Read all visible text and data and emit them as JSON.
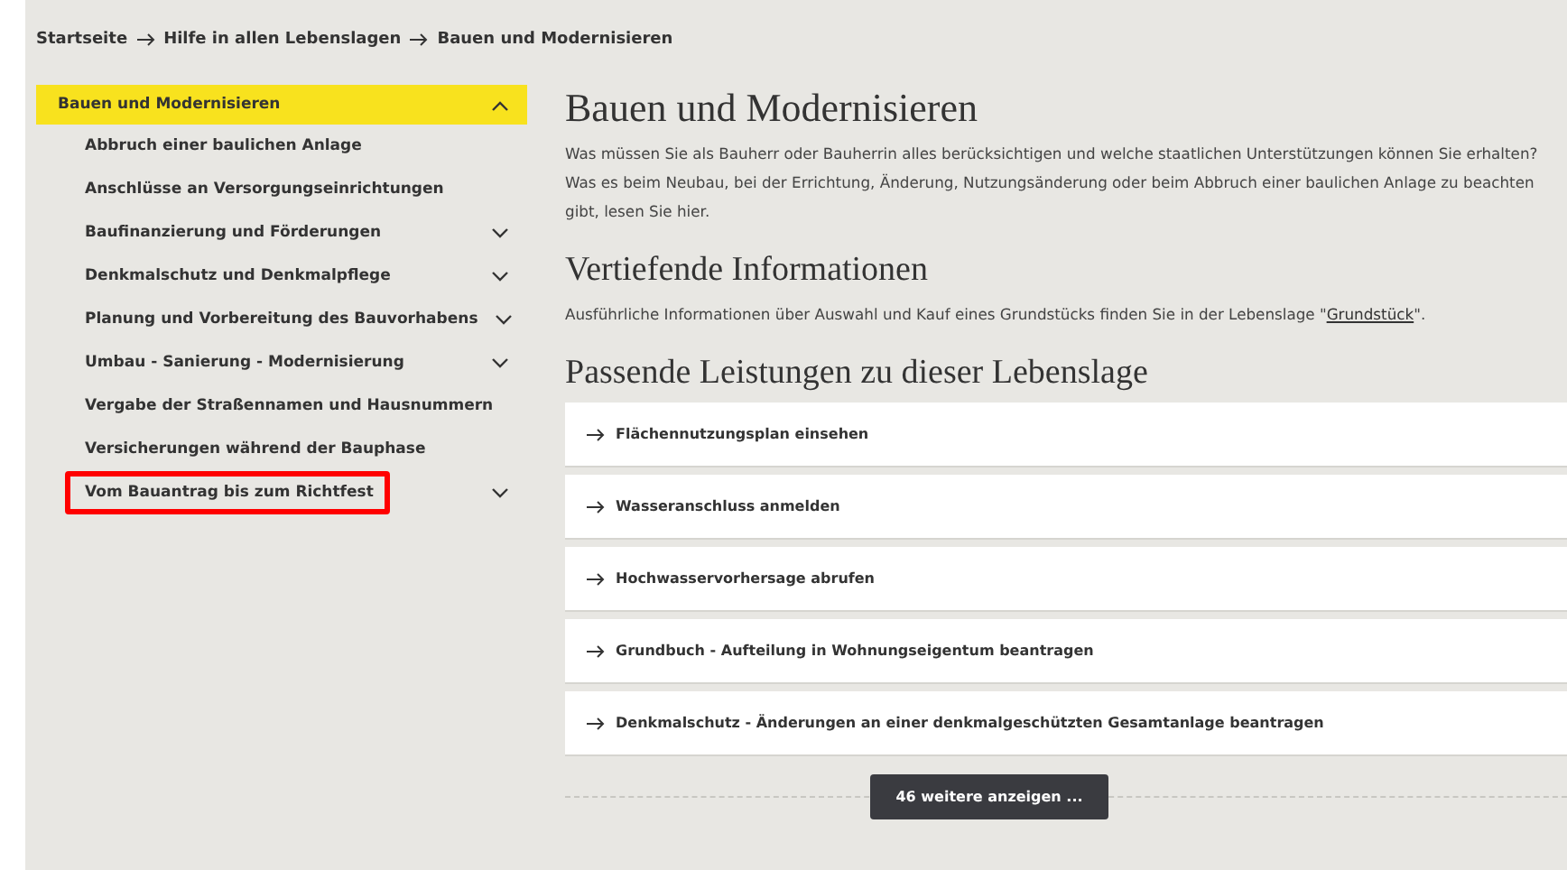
{
  "breadcrumb": [
    "Startseite",
    "Hilfe in allen Lebenslagen",
    "Bauen und Modernisieren"
  ],
  "sidebar": {
    "header": {
      "label": "Bauen und Modernisieren",
      "expanded": true
    },
    "items": [
      {
        "label": "Abbruch einer baulichen Anlage",
        "kind": "link",
        "highlighted": false
      },
      {
        "label": "Anschlüsse an Versorgungseinrichtungen",
        "kind": "link",
        "highlighted": false
      },
      {
        "label": "Baufinanzierung und Förderungen",
        "kind": "expandable",
        "highlighted": false
      },
      {
        "label": "Denkmalschutz und Denkmalpflege",
        "kind": "expandable",
        "highlighted": false
      },
      {
        "label": "Planung und Vorbereitung des Bauvorhabens",
        "kind": "expandable",
        "highlighted": false
      },
      {
        "label": "Umbau - Sanierung - Modernisierung",
        "kind": "expandable",
        "highlighted": false
      },
      {
        "label": "Vergabe der Straßennamen und Hausnummern",
        "kind": "link",
        "highlighted": false
      },
      {
        "label": "Versicherungen während der Bauphase",
        "kind": "link",
        "highlighted": false
      },
      {
        "label": "Vom Bauantrag bis zum Richtfest",
        "kind": "expandable",
        "highlighted": true
      }
    ]
  },
  "main": {
    "title": "Bauen und Modernisieren",
    "intro": "Was müssen Sie als Bauherr oder Bauherrin alles berücksichtigen und welche staatlichen Unterstützungen können Sie erhalten? Was es beim Neubau, bei der Errichtung, Änderung, Nutzungsänderung oder beim Abbruch einer baulichen Anlage zu beachten gibt, lesen Sie hier.",
    "info_heading": "Vertiefende Informationen",
    "info_text_before": "Ausführliche Informationen über Auswahl und Kauf eines Grundstücks finden Sie in der Lebenslage \"",
    "info_link": "Grundstück",
    "info_text_after": "\".",
    "services_heading": "Passende Leistungen zu dieser Lebenslage",
    "services": [
      "Flächennutzungsplan einsehen",
      "Wasseranschluss anmelden",
      "Hochwasservorhersage abrufen",
      "Grundbuch - Aufteilung in Wohnungseigentum beantragen",
      "Denkmalschutz - Änderungen an einer denkmalgeschützten Gesamtanlage beantragen"
    ],
    "more_button": "46 weitere anzeigen ..."
  }
}
